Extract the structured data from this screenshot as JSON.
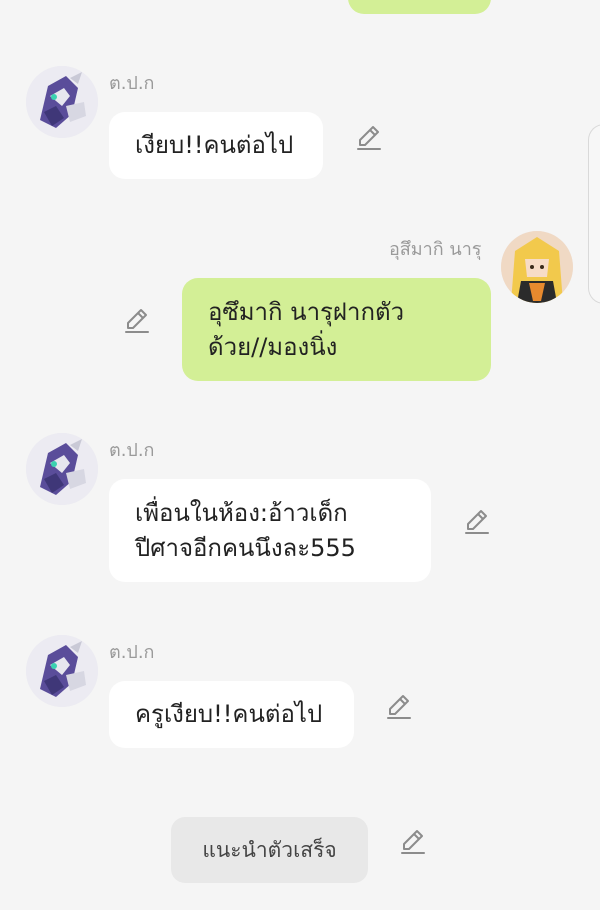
{
  "messages": [
    {
      "sender": "ต.ป.ก",
      "text": "เงียบ!!คนต่อไป"
    },
    {
      "sender": "อุสึมากิ นารุ",
      "text": "อุซึมากิ นารุฝากตัว\nด้วย//มองนิ่ง"
    },
    {
      "sender": "ต.ป.ก",
      "text": "เพื่อนในห้อง:อ้าวเด็ก\nปีศาจอีกคนนึงละ555"
    },
    {
      "sender": "ต.ป.ก",
      "text": "ครูเงียบ!!คนต่อไป"
    }
  ],
  "system_message": "แนะนำตัวเสร็จ",
  "icons": {
    "edit": "pencil-icon"
  },
  "colors": {
    "background": "#f5f5f5",
    "bubble_self": "#d3ef96",
    "bubble_other": "#ffffff",
    "system_bubble": "#e8e8e8"
  }
}
